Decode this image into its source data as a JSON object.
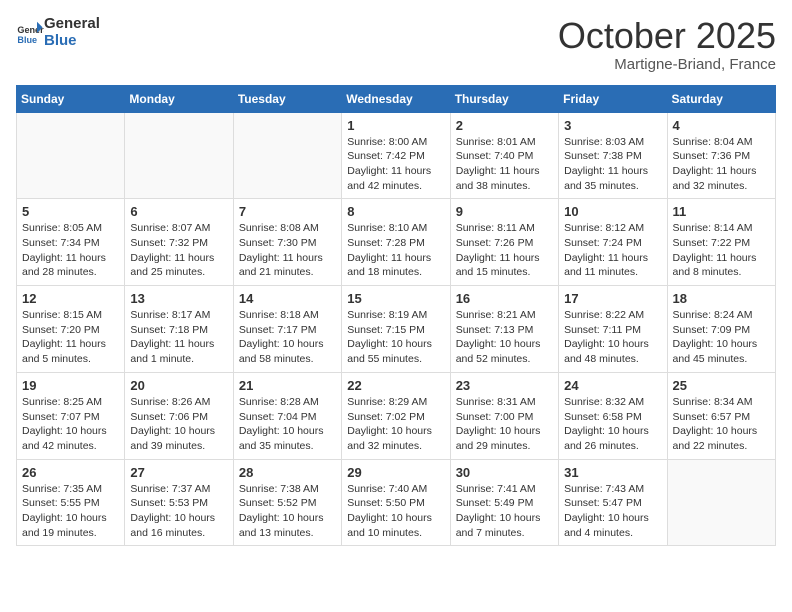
{
  "header": {
    "logo_general": "General",
    "logo_blue": "Blue",
    "month": "October 2025",
    "location": "Martigne-Briand, France"
  },
  "weekdays": [
    "Sunday",
    "Monday",
    "Tuesday",
    "Wednesday",
    "Thursday",
    "Friday",
    "Saturday"
  ],
  "weeks": [
    [
      {
        "day": "",
        "info": ""
      },
      {
        "day": "",
        "info": ""
      },
      {
        "day": "",
        "info": ""
      },
      {
        "day": "1",
        "info": "Sunrise: 8:00 AM\nSunset: 7:42 PM\nDaylight: 11 hours\nand 42 minutes."
      },
      {
        "day": "2",
        "info": "Sunrise: 8:01 AM\nSunset: 7:40 PM\nDaylight: 11 hours\nand 38 minutes."
      },
      {
        "day": "3",
        "info": "Sunrise: 8:03 AM\nSunset: 7:38 PM\nDaylight: 11 hours\nand 35 minutes."
      },
      {
        "day": "4",
        "info": "Sunrise: 8:04 AM\nSunset: 7:36 PM\nDaylight: 11 hours\nand 32 minutes."
      }
    ],
    [
      {
        "day": "5",
        "info": "Sunrise: 8:05 AM\nSunset: 7:34 PM\nDaylight: 11 hours\nand 28 minutes."
      },
      {
        "day": "6",
        "info": "Sunrise: 8:07 AM\nSunset: 7:32 PM\nDaylight: 11 hours\nand 25 minutes."
      },
      {
        "day": "7",
        "info": "Sunrise: 8:08 AM\nSunset: 7:30 PM\nDaylight: 11 hours\nand 21 minutes."
      },
      {
        "day": "8",
        "info": "Sunrise: 8:10 AM\nSunset: 7:28 PM\nDaylight: 11 hours\nand 18 minutes."
      },
      {
        "day": "9",
        "info": "Sunrise: 8:11 AM\nSunset: 7:26 PM\nDaylight: 11 hours\nand 15 minutes."
      },
      {
        "day": "10",
        "info": "Sunrise: 8:12 AM\nSunset: 7:24 PM\nDaylight: 11 hours\nand 11 minutes."
      },
      {
        "day": "11",
        "info": "Sunrise: 8:14 AM\nSunset: 7:22 PM\nDaylight: 11 hours\nand 8 minutes."
      }
    ],
    [
      {
        "day": "12",
        "info": "Sunrise: 8:15 AM\nSunset: 7:20 PM\nDaylight: 11 hours\nand 5 minutes."
      },
      {
        "day": "13",
        "info": "Sunrise: 8:17 AM\nSunset: 7:18 PM\nDaylight: 11 hours\nand 1 minute."
      },
      {
        "day": "14",
        "info": "Sunrise: 8:18 AM\nSunset: 7:17 PM\nDaylight: 10 hours\nand 58 minutes."
      },
      {
        "day": "15",
        "info": "Sunrise: 8:19 AM\nSunset: 7:15 PM\nDaylight: 10 hours\nand 55 minutes."
      },
      {
        "day": "16",
        "info": "Sunrise: 8:21 AM\nSunset: 7:13 PM\nDaylight: 10 hours\nand 52 minutes."
      },
      {
        "day": "17",
        "info": "Sunrise: 8:22 AM\nSunset: 7:11 PM\nDaylight: 10 hours\nand 48 minutes."
      },
      {
        "day": "18",
        "info": "Sunrise: 8:24 AM\nSunset: 7:09 PM\nDaylight: 10 hours\nand 45 minutes."
      }
    ],
    [
      {
        "day": "19",
        "info": "Sunrise: 8:25 AM\nSunset: 7:07 PM\nDaylight: 10 hours\nand 42 minutes."
      },
      {
        "day": "20",
        "info": "Sunrise: 8:26 AM\nSunset: 7:06 PM\nDaylight: 10 hours\nand 39 minutes."
      },
      {
        "day": "21",
        "info": "Sunrise: 8:28 AM\nSunset: 7:04 PM\nDaylight: 10 hours\nand 35 minutes."
      },
      {
        "day": "22",
        "info": "Sunrise: 8:29 AM\nSunset: 7:02 PM\nDaylight: 10 hours\nand 32 minutes."
      },
      {
        "day": "23",
        "info": "Sunrise: 8:31 AM\nSunset: 7:00 PM\nDaylight: 10 hours\nand 29 minutes."
      },
      {
        "day": "24",
        "info": "Sunrise: 8:32 AM\nSunset: 6:58 PM\nDaylight: 10 hours\nand 26 minutes."
      },
      {
        "day": "25",
        "info": "Sunrise: 8:34 AM\nSunset: 6:57 PM\nDaylight: 10 hours\nand 22 minutes."
      }
    ],
    [
      {
        "day": "26",
        "info": "Sunrise: 7:35 AM\nSunset: 5:55 PM\nDaylight: 10 hours\nand 19 minutes."
      },
      {
        "day": "27",
        "info": "Sunrise: 7:37 AM\nSunset: 5:53 PM\nDaylight: 10 hours\nand 16 minutes."
      },
      {
        "day": "28",
        "info": "Sunrise: 7:38 AM\nSunset: 5:52 PM\nDaylight: 10 hours\nand 13 minutes."
      },
      {
        "day": "29",
        "info": "Sunrise: 7:40 AM\nSunset: 5:50 PM\nDaylight: 10 hours\nand 10 minutes."
      },
      {
        "day": "30",
        "info": "Sunrise: 7:41 AM\nSunset: 5:49 PM\nDaylight: 10 hours\nand 7 minutes."
      },
      {
        "day": "31",
        "info": "Sunrise: 7:43 AM\nSunset: 5:47 PM\nDaylight: 10 hours\nand 4 minutes."
      },
      {
        "day": "",
        "info": ""
      }
    ]
  ]
}
